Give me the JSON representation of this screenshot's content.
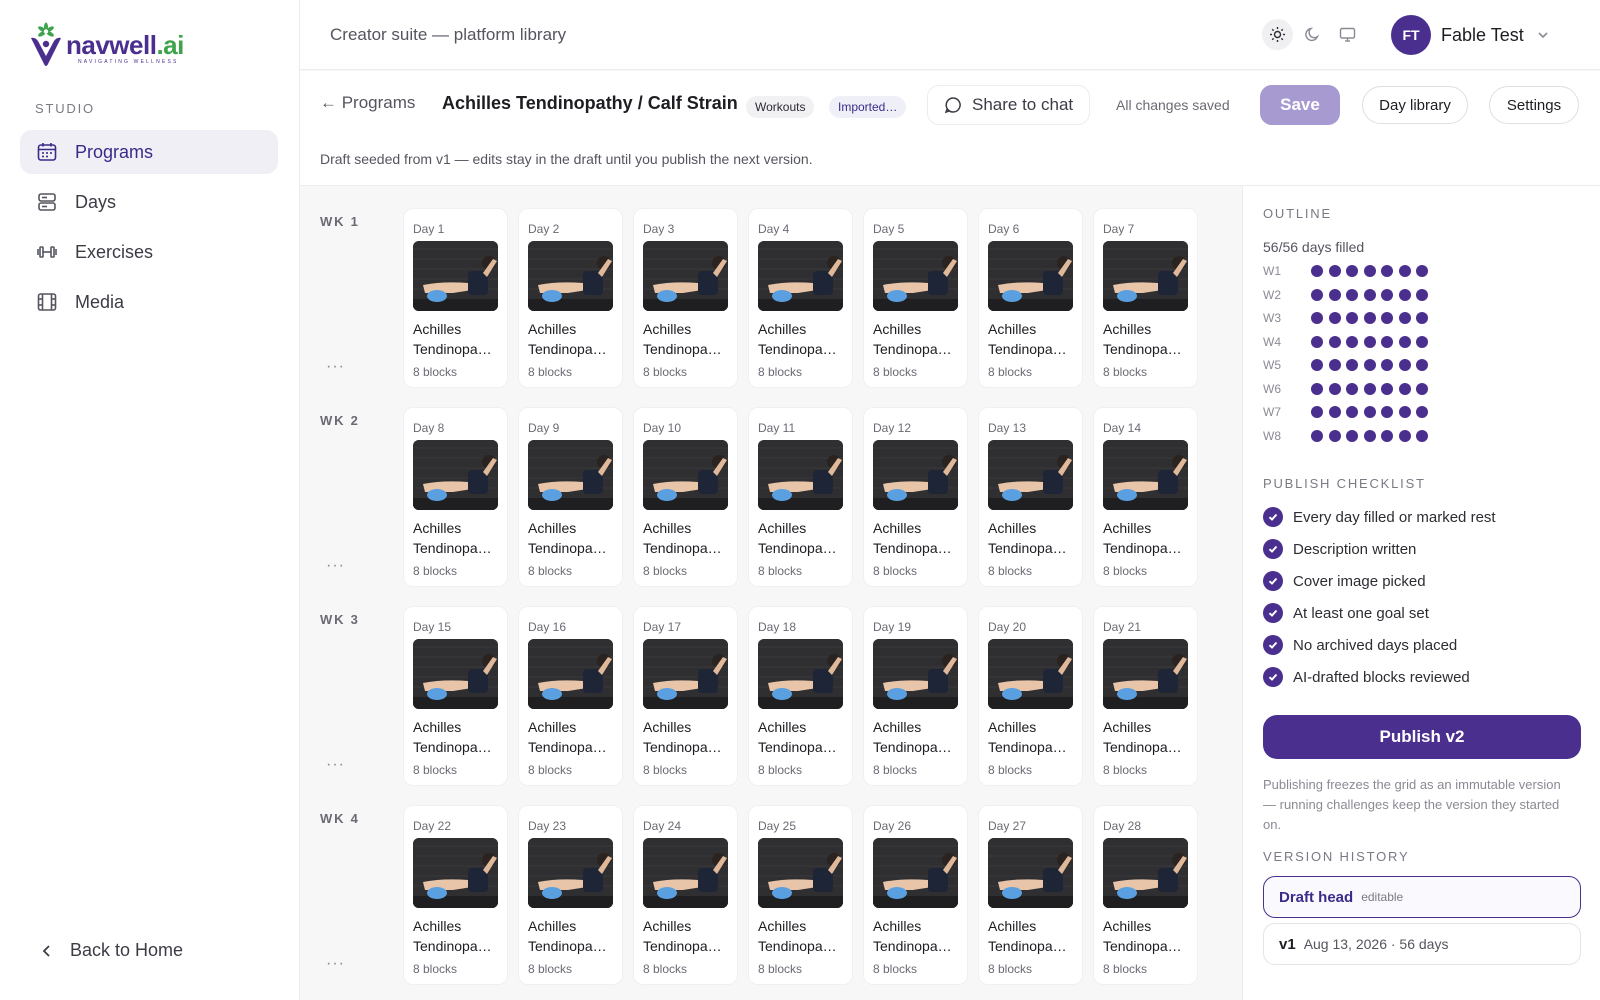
{
  "brand": {
    "name": "navwell",
    "suffix": ".ai",
    "tagline": "NAVIGATING WELLNESS",
    "primary": "#4b2f8f",
    "leaf": "#3fa34d"
  },
  "sidebar": {
    "section": "STUDIO",
    "items": [
      {
        "label": "Programs",
        "icon": "calendar-icon",
        "active": true
      },
      {
        "label": "Days",
        "icon": "stack-icon",
        "active": false
      },
      {
        "label": "Exercises",
        "icon": "dumbbell-icon",
        "active": false
      },
      {
        "label": "Media",
        "icon": "film-icon",
        "active": false
      }
    ],
    "back_home": "Back to Home"
  },
  "topbar": {
    "crumb": "Creator suite — platform library",
    "theme": [
      "sun-icon",
      "moon-icon",
      "monitor-icon"
    ],
    "user": {
      "initials": "FT",
      "name": "Fable Test"
    }
  },
  "program": {
    "back": "← Programs",
    "title": "Achilles Tendinopathy / Calf Strain",
    "chip_type": "Workouts",
    "chip_source": "Imported…",
    "share": "Share to chat",
    "status": "All changes saved",
    "save": "Save",
    "day_library": "Day library",
    "settings": "Settings",
    "draft_note": "Draft seeded from v1 — edits stay in the draft until you publish the next version."
  },
  "grid": {
    "more": "···",
    "weeks": [
      {
        "label": "WK 1",
        "days": [
          {
            "day": "Day 1",
            "line1": "Achilles",
            "line2": "Tendinopa…",
            "blocks": "8 blocks"
          },
          {
            "day": "Day 2",
            "line1": "Achilles",
            "line2": "Tendinopa…",
            "blocks": "8 blocks"
          },
          {
            "day": "Day 3",
            "line1": "Achilles",
            "line2": "Tendinopa…",
            "blocks": "8 blocks"
          },
          {
            "day": "Day 4",
            "line1": "Achilles",
            "line2": "Tendinopa…",
            "blocks": "8 blocks"
          },
          {
            "day": "Day 5",
            "line1": "Achilles",
            "line2": "Tendinopa…",
            "blocks": "8 blocks"
          },
          {
            "day": "Day 6",
            "line1": "Achilles",
            "line2": "Tendinopa…",
            "blocks": "8 blocks"
          },
          {
            "day": "Day 7",
            "line1": "Achilles",
            "line2": "Tendinopa…",
            "blocks": "8 blocks"
          }
        ]
      },
      {
        "label": "WK 2",
        "days": [
          {
            "day": "Day 8",
            "line1": "Achilles",
            "line2": "Tendinopa…",
            "blocks": "8 blocks"
          },
          {
            "day": "Day 9",
            "line1": "Achilles",
            "line2": "Tendinopa…",
            "blocks": "8 blocks"
          },
          {
            "day": "Day 10",
            "line1": "Achilles",
            "line2": "Tendinopa…",
            "blocks": "8 blocks"
          },
          {
            "day": "Day 11",
            "line1": "Achilles",
            "line2": "Tendinopa…",
            "blocks": "8 blocks"
          },
          {
            "day": "Day 12",
            "line1": "Achilles",
            "line2": "Tendinopa…",
            "blocks": "8 blocks"
          },
          {
            "day": "Day 13",
            "line1": "Achilles",
            "line2": "Tendinopa…",
            "blocks": "8 blocks"
          },
          {
            "day": "Day 14",
            "line1": "Achilles",
            "line2": "Tendinopa…",
            "blocks": "8 blocks"
          }
        ]
      },
      {
        "label": "WK 3",
        "days": [
          {
            "day": "Day 15",
            "line1": "Achilles",
            "line2": "Tendinopa…",
            "blocks": "8 blocks"
          },
          {
            "day": "Day 16",
            "line1": "Achilles",
            "line2": "Tendinopa…",
            "blocks": "8 blocks"
          },
          {
            "day": "Day 17",
            "line1": "Achilles",
            "line2": "Tendinopa…",
            "blocks": "8 blocks"
          },
          {
            "day": "Day 18",
            "line1": "Achilles",
            "line2": "Tendinopa…",
            "blocks": "8 blocks"
          },
          {
            "day": "Day 19",
            "line1": "Achilles",
            "line2": "Tendinopa…",
            "blocks": "8 blocks"
          },
          {
            "day": "Day 20",
            "line1": "Achilles",
            "line2": "Tendinopa…",
            "blocks": "8 blocks"
          },
          {
            "day": "Day 21",
            "line1": "Achilles",
            "line2": "Tendinopa…",
            "blocks": "8 blocks"
          }
        ]
      },
      {
        "label": "WK 4",
        "days": [
          {
            "day": "Day 22",
            "line1": "Achilles",
            "line2": "Tendinopa…",
            "blocks": "8 blocks"
          },
          {
            "day": "Day 23",
            "line1": "Achilles",
            "line2": "Tendinopa…",
            "blocks": "8 blocks"
          },
          {
            "day": "Day 24",
            "line1": "Achilles",
            "line2": "Tendinopa…",
            "blocks": "8 blocks"
          },
          {
            "day": "Day 25",
            "line1": "Achilles",
            "line2": "Tendinopa…",
            "blocks": "8 blocks"
          },
          {
            "day": "Day 26",
            "line1": "Achilles",
            "line2": "Tendinopa…",
            "blocks": "8 blocks"
          },
          {
            "day": "Day 27",
            "line1": "Achilles",
            "line2": "Tendinopa…",
            "blocks": "8 blocks"
          },
          {
            "day": "Day 28",
            "line1": "Achilles",
            "line2": "Tendinopa…",
            "blocks": "8 blocks"
          }
        ]
      }
    ]
  },
  "outline": {
    "label": "OUTLINE",
    "filled": "56/56 days filled",
    "weeks": [
      {
        "label": "W1",
        "filled": 7
      },
      {
        "label": "W2",
        "filled": 7
      },
      {
        "label": "W3",
        "filled": 7
      },
      {
        "label": "W4",
        "filled": 7
      },
      {
        "label": "W5",
        "filled": 7
      },
      {
        "label": "W6",
        "filled": 7
      },
      {
        "label": "W7",
        "filled": 7
      },
      {
        "label": "W8",
        "filled": 7
      }
    ]
  },
  "checklist": {
    "label": "PUBLISH CHECKLIST",
    "items": [
      "Every day filled or marked rest",
      "Description written",
      "Cover image picked",
      "At least one goal set",
      "No archived days placed",
      "AI-drafted blocks reviewed"
    ],
    "publish": "Publish v2",
    "note": "Publishing freezes the grid as an immutable version — running challenges keep the version they started on."
  },
  "history": {
    "label": "VERSION HISTORY",
    "draft_name": "Draft head",
    "draft_tag": "editable",
    "v1_name": "v1",
    "v1_meta": "Aug 13, 2026 · 56 days"
  }
}
